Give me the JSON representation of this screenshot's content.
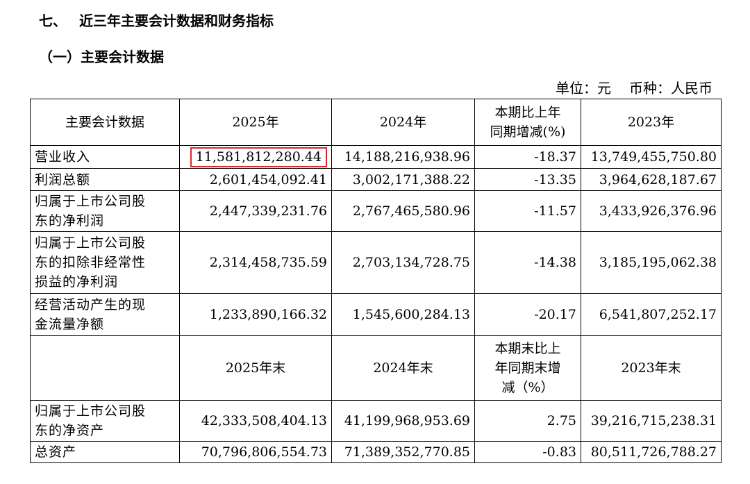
{
  "section": {
    "number": "七、",
    "title": "近三年主要会计数据和财务指标"
  },
  "subsection": {
    "title": "（一）主要会计数据"
  },
  "unit_line": {
    "unit": "单位：元",
    "currency": "币种：人民币"
  },
  "table": {
    "header1": {
      "label": "主要会计数据",
      "y2025": "2025年",
      "y2024": "2024年",
      "change_l1": "本期比上年",
      "change_l2": "同期增减(%)",
      "y2023": "2023年"
    },
    "rows1": [
      {
        "label_lines": [
          "营业收入"
        ],
        "y2025": "11,581,812,280.44",
        "y2024": "14,188,216,938.96",
        "change": "-18.37",
        "y2023": "13,749,455,750.80",
        "highlighted": true
      },
      {
        "label_lines": [
          "利润总额"
        ],
        "y2025": "2,601,454,092.41",
        "y2024": "3,002,171,388.22",
        "change": "-13.35",
        "y2023": "3,964,628,187.67"
      },
      {
        "label_lines": [
          "归属于上市公司股",
          "东的净利润"
        ],
        "y2025": "2,447,339,231.76",
        "y2024": "2,767,465,580.96",
        "change": "-11.57",
        "y2023": "3,433,926,376.96"
      },
      {
        "label_lines": [
          "归属于上市公司股",
          "东的扣除非经常性",
          "损益的净利润"
        ],
        "y2025": "2,314,458,735.59",
        "y2024": "2,703,134,728.75",
        "change": "-14.38",
        "y2023": "3,185,195,062.38"
      },
      {
        "label_lines": [
          "经营活动产生的现",
          "金流量净额"
        ],
        "y2025": "1,233,890,166.32",
        "y2024": "1,545,600,284.13",
        "change": "-20.17",
        "y2023": "6,541,807,252.17"
      }
    ],
    "header2": {
      "label": "",
      "y2025": "2025年末",
      "y2024": "2024年末",
      "change_l1": "本期末比上",
      "change_l2": "年同期末增",
      "change_l3": "减（%）",
      "y2023": "2023年末"
    },
    "rows2": [
      {
        "label_lines": [
          "归属于上市公司股",
          "东的净资产"
        ],
        "y2025": "42,333,508,404.13",
        "y2024": "41,199,968,953.69",
        "change": "2.75",
        "y2023": "39,216,715,238.31"
      },
      {
        "label_lines": [
          "总资产"
        ],
        "y2025": "70,796,806,554.73",
        "y2024": "71,389,352,770.85",
        "change": "-0.83",
        "y2023": "80,511,726,788.27"
      }
    ]
  },
  "colors": {
    "highlight_border": "#d8282e",
    "text": "#000000",
    "rule": "#000000"
  }
}
